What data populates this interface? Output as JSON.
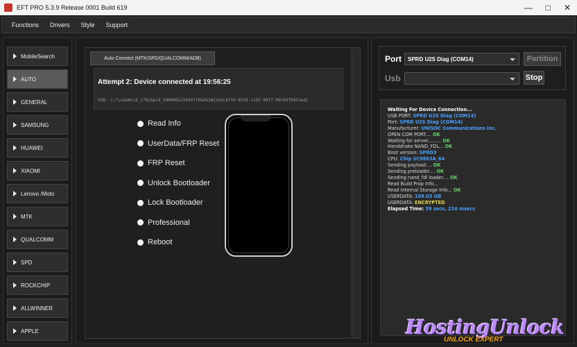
{
  "window": {
    "title": "EFT PRO 5.3.9 Release 0001 Build 619",
    "controls": [
      "—",
      "□",
      "✕"
    ]
  },
  "menu": [
    "Functions",
    "Drivers",
    "Style",
    "Support"
  ],
  "sidebar": [
    {
      "label": "MobileSearch"
    },
    {
      "label": "AUTO",
      "active": true
    },
    {
      "label": "GENERAL"
    },
    {
      "label": "SAMSUNG"
    },
    {
      "label": "HUAWEI"
    },
    {
      "label": "XIAOMI"
    },
    {
      "label": "Lenovo /Moto"
    },
    {
      "label": "MTK"
    },
    {
      "label": "QUALCOMM"
    },
    {
      "label": "SPD"
    },
    {
      "label": "ROCKCHIP"
    },
    {
      "label": "ALLWINNER"
    },
    {
      "label": "APPLE"
    }
  ],
  "center": {
    "tab_label": "Auto Connect (MTK/SPD/QUALCOMM/ADB)",
    "status_title": "Attempt 2: Device connected at 19:56:25",
    "usb_path": "USB: \\\\?\\usb#vid_1782&pid_4d00#5&15499710&0&1#{a5dcbf10-6530-11d2-901f-00c04fb951ed}",
    "options": [
      "Read Info",
      "UserData/FRP Reset",
      "FRP Reset",
      "Unlock Bootloader",
      "Lock Bootloader",
      "Professional",
      "Reboot"
    ]
  },
  "right": {
    "port_label": "Port",
    "port_value": "SPRD U2S Diag (COM14)",
    "partition_label": "Partition",
    "usb_label": "Usb",
    "usb_value": "",
    "stop_label": "Stop",
    "log": [
      {
        "label": "Waiting For Device Connection...",
        "value": "",
        "tone": "strong"
      },
      {
        "label": "USB PORT: ",
        "value": "SPRD U2S Diag (COM14)",
        "tone": "blue"
      },
      {
        "label": "Port: ",
        "value": "SPRD U2S Diag (COM14)",
        "tone": "blue"
      },
      {
        "label": "Manufacturer: ",
        "value": "UNISOC Communications Inc.",
        "tone": "blue"
      },
      {
        "label": "OPEN COM PORT.... ",
        "value": "OK",
        "tone": "green"
      },
      {
        "label": "Waiting for server......... ",
        "value": "OK",
        "tone": "green"
      },
      {
        "label": "Handshake NAND_FDL... ",
        "value": "OK",
        "tone": "green"
      },
      {
        "label": "Boot version: ",
        "value": "SPRD3",
        "tone": "blue"
      },
      {
        "label": "CPU: ",
        "value": "Chip SC9863A_64",
        "tone": "blue"
      },
      {
        "label": "Sending payload.... ",
        "value": "OK",
        "tone": "green"
      },
      {
        "label": "Sending preloader.... ",
        "value": "OK",
        "tone": "green"
      },
      {
        "label": "Sending nand_fdl loader.... ",
        "value": "OK",
        "tone": "green"
      },
      {
        "label": "Read Build Prop Info...",
        "value": "",
        "tone": "none"
      },
      {
        "label": "Read Internal Storage Info... ",
        "value": "OK",
        "tone": "green"
      },
      {
        "label": "USERDATA: ",
        "value": "109.03 GB",
        "tone": "blue"
      },
      {
        "label": "USERDATA: ",
        "value": "ENCRYPTED",
        "tone": "yellow"
      },
      {
        "label": "Elapsed Time: ",
        "value": "59 secs, 234 msecs",
        "tone": "blue-strong"
      }
    ],
    "watermark": "HostingUnlock",
    "watermark_sub": "UNLOCK EXPERT"
  },
  "colors": {
    "accent_blue": "#4aa0ff",
    "ok_green": "#6bd36b",
    "warn_yellow": "#e6d44a"
  }
}
